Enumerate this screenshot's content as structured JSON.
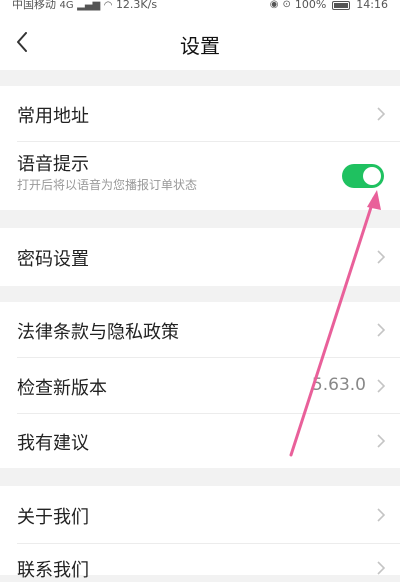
{
  "status_bar": {
    "carrier": "中国移动",
    "network": "4G",
    "speed": "12.3K/s",
    "battery": "100%",
    "time": "14:16"
  },
  "header": {
    "title": "设置"
  },
  "settings": {
    "common_address": "常用地址",
    "voice_prompt": {
      "label": "语音提示",
      "description": "打开后将以语音为您播报订单状态",
      "enabled": true
    },
    "password": "密码设置",
    "legal": "法律条款与隐私政策",
    "check_update": {
      "label": "检查新版本",
      "version": "5.63.0"
    },
    "suggestion": "我有建议",
    "about": "关于我们",
    "contact": "联系我们"
  },
  "colors": {
    "toggle_on": "#1fc160",
    "annotation_arrow": "#e9609a"
  }
}
